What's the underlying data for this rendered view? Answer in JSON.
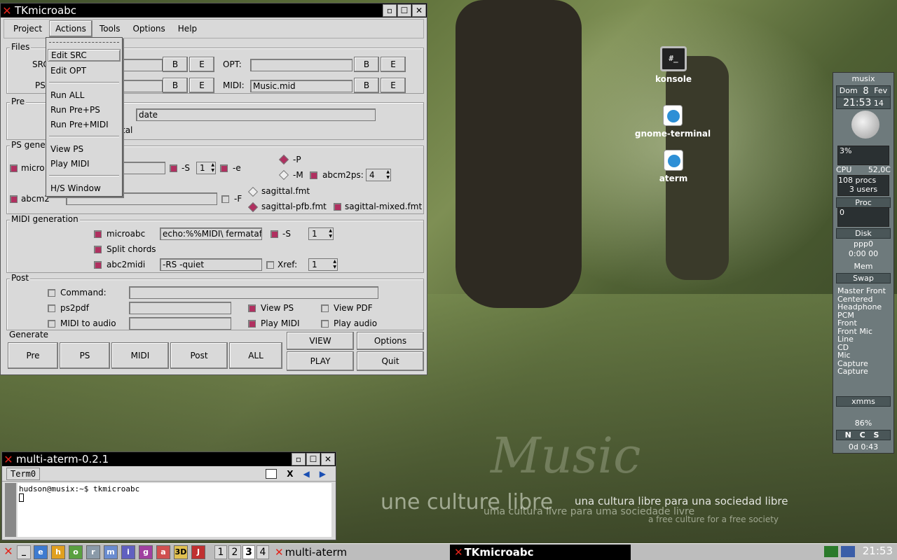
{
  "wallpaper": {
    "script": "Music",
    "line1": "une culture libre",
    "line2": "una cultura libre para una sociedad libre",
    "line3": "uma cultura livre para uma sociedade livre",
    "line4": "a free culture for a free society"
  },
  "desktop_icons": [
    {
      "label": "konsole",
      "glyph": "#_"
    },
    {
      "label": "gnome-terminal"
    },
    {
      "label": "aterm"
    }
  ],
  "tk": {
    "title": "TKmicroabc",
    "menus": [
      "Project",
      "Actions",
      "Tools",
      "Options",
      "Help"
    ],
    "dropdown": [
      "Edit SRC",
      "Edit OPT",
      "Run ALL",
      "Run Pre+PS",
      "Run Pre+MIDI",
      "View PS",
      "Play MIDI",
      "H/S Window"
    ],
    "files": {
      "label": "Files",
      "src_label": "SRC",
      "ps_label": "PS",
      "opt_label": "OPT:",
      "midi_label": "MIDI:",
      "midi_value": "Music.mid",
      "b": "B",
      "e": "E"
    },
    "pre": {
      "label": "Pre",
      "date": "date",
      "tal": "tal"
    },
    "psgen": {
      "label": "PS gener",
      "micro": "micro",
      "s": "-S",
      "s_val": "1",
      "e": "-e",
      "p": "-P",
      "m": "-M",
      "abcm2ps": "abcm2ps:",
      "abcm2ps_val": "4",
      "abcm2": "abcm2",
      "f": "-F",
      "sagittal": "sagittal.fmt",
      "sagittal_pfb": "sagittal-pfb.fmt",
      "sagittal_mixed": "sagittal-mixed.fmt"
    },
    "midigen": {
      "label": "MIDI generation",
      "microabc": "microabc",
      "echo": "echo:%%MIDI\\ fermatafixe",
      "s": "-S",
      "s_val": "1",
      "split": "Split chords",
      "abc2midi": "abc2midi",
      "rs": "-RS -quiet",
      "xref": "Xref:",
      "xref_val": "1"
    },
    "post": {
      "label": "Post",
      "command": "Command:",
      "ps2pdf": "ps2pdf",
      "view_ps": "View PS",
      "view_pdf": "View PDF",
      "midi_audio": "MIDI to audio",
      "play_midi": "Play MIDI",
      "play_audio": "Play audio"
    },
    "generate": {
      "label": "Generate",
      "buttons": [
        "Pre",
        "PS",
        "MIDI",
        "Post",
        "ALL"
      ],
      "view": "VIEW",
      "options": "Options",
      "play": "PLAY",
      "quit": "Quit"
    }
  },
  "term": {
    "title": "multi-aterm-0.2.1",
    "tab": "Term0",
    "close": "X",
    "line1": "hudson@musix:~$ tkmicroabc"
  },
  "gk": {
    "host": "musix",
    "day": "Dom",
    "date": "8",
    "month": "Fev",
    "time": "21:53",
    "sec": "14",
    "cpu_pct": "3%",
    "cpu": "CPU",
    "temp": "52,0C",
    "procs": "108 procs",
    "users": "3 users",
    "proc": "Proc",
    "proc_val": "0",
    "disk": "Disk",
    "ppp": "ppp0",
    "ppp_time": "0:00 00",
    "mem": "Mem",
    "swap": "Swap",
    "mixer": [
      "Master Front",
      "Centered",
      "Headphone",
      "PCM",
      "Front",
      "Front Mic",
      "Line",
      "CD",
      "Mic",
      "Capture",
      "Capture"
    ],
    "xmms": "xmms",
    "battery": "86%",
    "ncs": "N C S",
    "uptime": "0d 0:43"
  },
  "taskbar": {
    "min": "_",
    "launchers": [
      "e",
      "h",
      "o",
      "r",
      "m",
      "i",
      "g",
      "a",
      "3D",
      "J"
    ],
    "desktops": [
      "1",
      "2",
      "3",
      "4"
    ],
    "task1": "multi-aterm",
    "task2": "TKmicroabc",
    "clock": "21:53"
  },
  "colors": {
    "checked": "#b03060",
    "window_bg": "#d9d9d9",
    "titlebar": "#000000",
    "close_x": "#e2231a"
  }
}
